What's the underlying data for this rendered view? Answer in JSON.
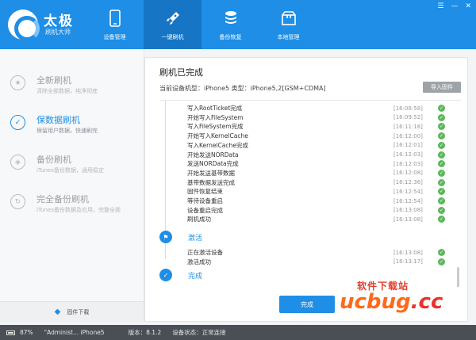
{
  "app": {
    "name": "太极",
    "subtitle": "刷机大师"
  },
  "window_controls": {
    "skin": "☰",
    "minimize": "—",
    "close": "✕"
  },
  "nav": [
    {
      "label": "设备管理",
      "icon": "phone-icon",
      "active": false
    },
    {
      "label": "一键刷机",
      "icon": "rocket-icon",
      "active": true
    },
    {
      "label": "备份恢复",
      "icon": "database-icon",
      "active": false
    },
    {
      "label": "本地管理",
      "icon": "box-icon",
      "active": false
    }
  ],
  "sidebar": {
    "items": [
      {
        "title": "全新刷机",
        "desc": "清除全部数据，纯净彻底",
        "icon": "star-icon",
        "active": false
      },
      {
        "title": "保数据刷机",
        "desc": "保留用户数据，快速刷完",
        "icon": "check-icon",
        "active": true
      },
      {
        "title": "备份刷机",
        "desc": "iTunes备份数据，通用稳定",
        "icon": "compass-icon",
        "active": false
      },
      {
        "title": "完全备份刷机",
        "desc": "iTunes备份数据及应用，完整全面",
        "icon": "cycle-icon",
        "active": false
      }
    ],
    "firmware_download": "固件下载"
  },
  "panel": {
    "title": "刷机已完成",
    "device_info": "当前设备机型：iPhone5 类型：iPhone5,2[GSM+CDMA]",
    "import_button": "导入固件",
    "done_button": "完成"
  },
  "log": {
    "rows_stage1": [
      {
        "text": "写入RootTicket完成",
        "time": "[16:08:58]"
      },
      {
        "text": "开始写入FileSystem",
        "time": "[16:09:52]"
      },
      {
        "text": "写入FileSystem完成",
        "time": "[16:11:18]"
      },
      {
        "text": "开始写入KernelCache",
        "time": "[16:12:00]"
      },
      {
        "text": "写入KernelCache完成",
        "time": "[16:12:01]"
      },
      {
        "text": "开始发送NORData",
        "time": "[16:12:03]"
      },
      {
        "text": "发送NORData完成",
        "time": "[16:12:03]"
      },
      {
        "text": "开始发送基带数据",
        "time": "[16:12:08]"
      },
      {
        "text": "基带数据发送完成",
        "time": "[16:12:36]"
      },
      {
        "text": "固件恢复结束",
        "time": "[16:12:54]"
      },
      {
        "text": "等待设备重启",
        "time": "[16:12:54]"
      },
      {
        "text": "设备重启完成",
        "time": "[16:13:08]"
      },
      {
        "text": "刷机成功",
        "time": "[16:13:08]"
      }
    ],
    "stage_activate": "激活",
    "rows_stage2": [
      {
        "text": "正在激活设备",
        "time": "[16:13:08]"
      },
      {
        "text": "激活成功",
        "time": "[16:13:17]"
      }
    ],
    "stage_done": "完成"
  },
  "watermark": {
    "top": "软件下载站",
    "main": "ucbug",
    "suffix": ".cc"
  },
  "statusbar": {
    "battery": "87%",
    "user": "\"Administ...  iPhone5",
    "version": "版本：8.1.2",
    "device_status": "设备状态：正常连接"
  }
}
